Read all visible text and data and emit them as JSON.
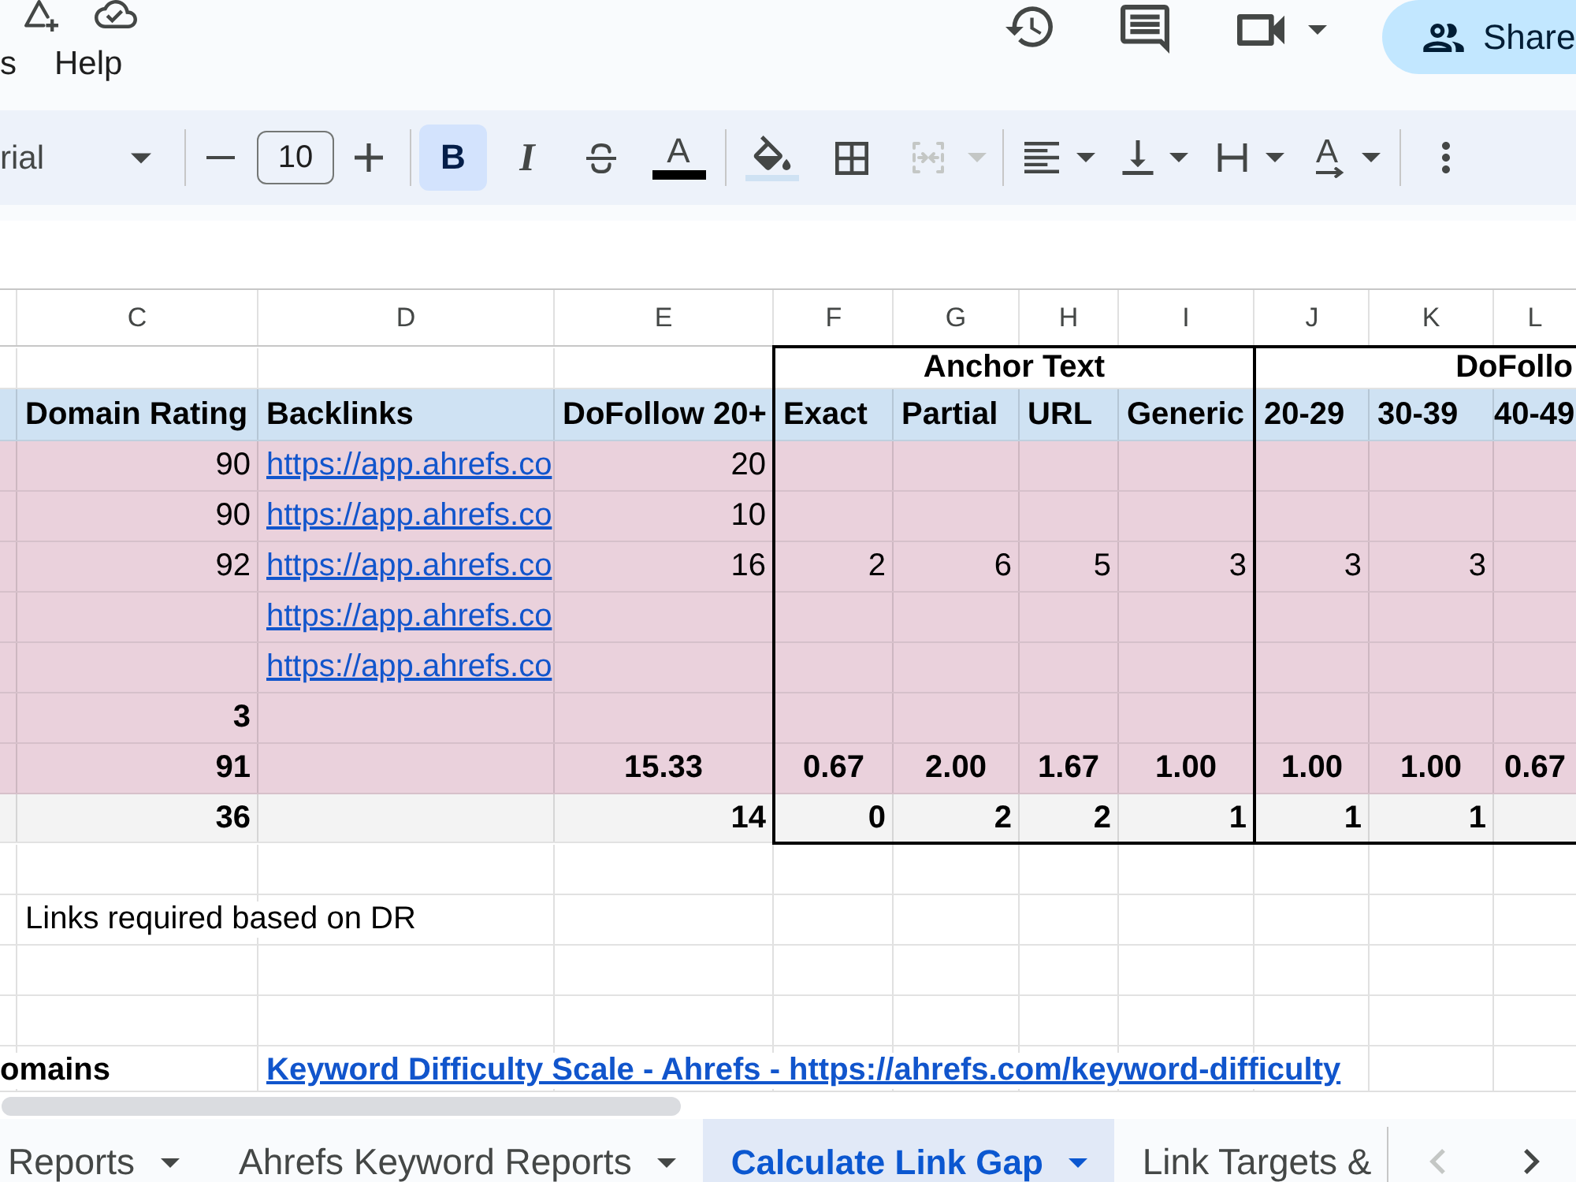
{
  "menu_bar": {
    "menus": [
      {
        "label": "s"
      },
      {
        "label": "Help"
      }
    ]
  },
  "header_actions": {
    "share_button": {
      "label": "Share"
    }
  },
  "toolbar": {
    "font_name": "rial",
    "font_size": "10",
    "format_toggles": [
      {
        "kind": "bold",
        "glyph": "B",
        "selected": true
      },
      {
        "kind": "italic",
        "glyph": "I",
        "selected": false
      },
      {
        "kind": "strikethrough",
        "selected": false
      }
    ],
    "text_color": {
      "glyph": "A",
      "color": "#000000"
    },
    "fill_color": {
      "color": "#cfe2f3"
    },
    "merge_cells": {
      "disabled": true
    },
    "text_rotation": {
      "glyph": "A"
    }
  },
  "sheet": {
    "column_headers": [
      "C",
      "D",
      "E",
      "F",
      "G",
      "H",
      "I",
      "J",
      "K",
      "L"
    ],
    "rows": [
      {
        "kind": "group",
        "groups": {
          "f": "Anchor Text",
          "j": "DoFollo"
        }
      },
      {
        "kind": "header",
        "cells": {
          "c": {
            "kind": "text",
            "text": "Domain Rating"
          },
          "d": {
            "kind": "text",
            "text": "Backlinks"
          },
          "e": {
            "kind": "text",
            "text": "DoFollow 20+"
          },
          "f": {
            "kind": "text",
            "text": "Exact"
          },
          "g": {
            "kind": "text",
            "text": "Partial"
          },
          "h": {
            "kind": "text",
            "text": "URL"
          },
          "i": {
            "kind": "text",
            "text": "Generic"
          },
          "j": {
            "kind": "text",
            "text": "20-29"
          },
          "k": {
            "kind": "text",
            "text": "30-39"
          },
          "l": {
            "kind": "text",
            "text": "40-49"
          }
        }
      },
      {
        "kind": "data",
        "cells": {
          "c": {
            "kind": "number",
            "text": "90"
          },
          "d": {
            "kind": "link",
            "text": "https://app.ahrefs.co"
          },
          "e": {
            "kind": "number",
            "text": "20"
          }
        }
      },
      {
        "kind": "data",
        "cells": {
          "c": {
            "kind": "number",
            "text": "90"
          },
          "d": {
            "kind": "link",
            "text": "https://app.ahrefs.co"
          },
          "e": {
            "kind": "number",
            "text": "10"
          }
        }
      },
      {
        "kind": "data",
        "cells": {
          "c": {
            "kind": "number",
            "text": "92"
          },
          "d": {
            "kind": "link",
            "text": "https://app.ahrefs.co"
          },
          "e": {
            "kind": "number",
            "text": "16"
          },
          "f": {
            "kind": "number",
            "text": "2"
          },
          "g": {
            "kind": "number",
            "text": "6"
          },
          "h": {
            "kind": "number",
            "text": "5"
          },
          "i": {
            "kind": "number",
            "text": "3"
          },
          "j": {
            "kind": "number",
            "text": "3"
          },
          "k": {
            "kind": "number",
            "text": "3"
          }
        }
      },
      {
        "kind": "data",
        "cells": {
          "d": {
            "kind": "link",
            "text": "https://app.ahrefs.co"
          }
        }
      },
      {
        "kind": "data",
        "cells": {
          "d": {
            "kind": "link",
            "text": "https://app.ahrefs.co"
          }
        }
      },
      {
        "kind": "summary",
        "cells": {
          "c": {
            "kind": "number",
            "text": "3"
          }
        }
      },
      {
        "kind": "summary",
        "cells": {
          "c": {
            "kind": "number",
            "text": "91"
          },
          "e": {
            "kind": "average",
            "text": "15.33"
          },
          "f": {
            "kind": "average",
            "text": "0.67"
          },
          "g": {
            "kind": "average",
            "text": "2.00"
          },
          "h": {
            "kind": "average",
            "text": "1.67"
          },
          "i": {
            "kind": "average",
            "text": "1.00"
          },
          "j": {
            "kind": "average",
            "text": "1.00"
          },
          "k": {
            "kind": "average",
            "text": "1.00"
          },
          "l": {
            "kind": "average",
            "text": "0.67"
          }
        }
      },
      {
        "kind": "total",
        "cells": {
          "c": {
            "kind": "number",
            "text": "36"
          },
          "e": {
            "kind": "number",
            "text": "14"
          },
          "f": {
            "kind": "number",
            "text": "0"
          },
          "g": {
            "kind": "number",
            "text": "2"
          },
          "h": {
            "kind": "number",
            "text": "2"
          },
          "i": {
            "kind": "number",
            "text": "1"
          },
          "j": {
            "kind": "number",
            "text": "1"
          },
          "k": {
            "kind": "number",
            "text": "1"
          }
        }
      },
      {
        "kind": "blank"
      },
      {
        "kind": "note",
        "cells": {
          "c": {
            "kind": "text",
            "text": "Links required based on DR"
          }
        }
      },
      {
        "kind": "blank"
      },
      {
        "kind": "blank"
      },
      {
        "kind": "footer",
        "cells": {
          "b": {
            "kind": "text",
            "text": "omains"
          },
          "d": {
            "kind": "link",
            "text": "Keyword Difficulty Scale - Ahrefs - https://ahrefs.com/keyword-difficulty"
          }
        }
      }
    ]
  },
  "sheet_tabs": {
    "tabs": [
      {
        "label": "Reports",
        "selected": false,
        "dropdown": true
      },
      {
        "label": "Ahrefs Keyword Reports",
        "selected": false,
        "dropdown": true
      },
      {
        "label": "Calculate Link Gap",
        "selected": true,
        "dropdown": true
      },
      {
        "label": "Link Targets &",
        "selected": false,
        "dropdown": false
      }
    ],
    "scroll_buttons": [
      {
        "kind": "left",
        "disabled": true
      },
      {
        "kind": "right",
        "disabled": false
      }
    ]
  }
}
